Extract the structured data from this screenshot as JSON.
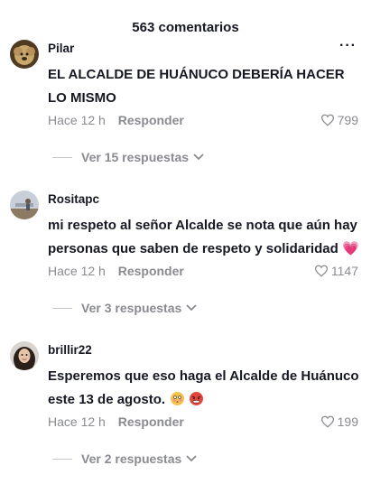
{
  "header": {
    "title": "563 comentarios"
  },
  "comments": [
    {
      "username": "Pilar",
      "text": "EL ALCALDE DE HUÁNUCO DEBERÍA HACER LO MISMO",
      "time": "Hace 12 h",
      "reply_label": "Responder",
      "likes": "799",
      "replies_label": "Ver 15 respuestas"
    },
    {
      "username": "Rositapc",
      "text": "mi respeto al señor Alcalde se nota que aún hay personas que saben de respeto y solidaridad",
      "emoji": "💗",
      "time": "Hace 12 h",
      "reply_label": "Responder",
      "likes": "1147",
      "replies_label": "Ver 3 respuestas"
    },
    {
      "username": "brillir22",
      "text": "Esperemos que eso haga el Alcalde de Huánuco este 13 de agosto.",
      "time": "Hace 12 h",
      "reply_label": "Responder",
      "likes": "199",
      "replies_label": "Ver 2 respuestas"
    }
  ],
  "icons": {
    "more": "more-options-icon",
    "like": "heart-outline-icon",
    "expand": "chevron-down-icon"
  },
  "colors": {
    "text": "#161823",
    "muted": "#8a8b91",
    "heart_emoji": "#ff3b7f"
  }
}
